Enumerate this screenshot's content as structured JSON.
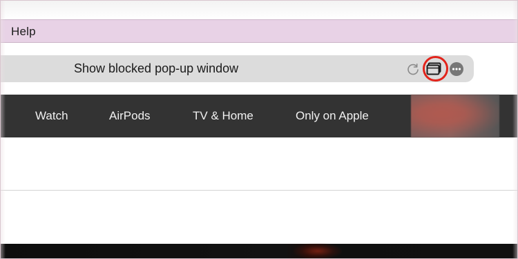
{
  "menu": {
    "help_label": "Help"
  },
  "address_bar": {
    "status_text": "Show blocked pop-up window"
  },
  "toolbar_icons": {
    "reload": "reload-icon",
    "popup": "show-blocked-popup-window-icon",
    "more": "more-icon"
  },
  "nav": {
    "items": [
      {
        "label": "Watch"
      },
      {
        "label": "AirPods"
      },
      {
        "label": "TV & Home"
      },
      {
        "label": "Only on Apple"
      }
    ]
  },
  "colors": {
    "menubar_background": "#e8d2e6",
    "addressbar_background": "#dcdcdc",
    "navbar_background": "#333333",
    "popup_highlight": "#e2231a"
  }
}
